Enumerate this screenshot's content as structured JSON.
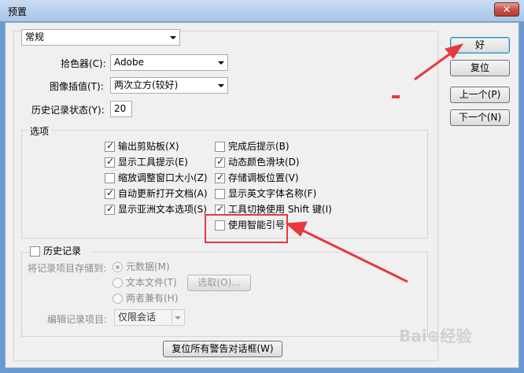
{
  "window": {
    "title": "预置",
    "close": "✕"
  },
  "general": {
    "section_select": "常规",
    "color_picker_label": "拾色器(C):",
    "color_picker_value": "Adobe",
    "interp_label": "图像插值(T):",
    "interp_value": "两次立方(较好)",
    "history_states_label": "历史记录状态(Y):",
    "history_states_value": "20"
  },
  "options": {
    "title": "选项",
    "left": [
      {
        "label": "输出剪贴板(X)",
        "checked": true
      },
      {
        "label": "显示工具提示(E)",
        "checked": true
      },
      {
        "label": "缩放调整窗口大小(Z)",
        "checked": false
      },
      {
        "label": "自动更新打开文档(A)",
        "checked": true
      },
      {
        "label": "显示亚洲文本选项(S)",
        "checked": true
      }
    ],
    "right": [
      {
        "label": "完成后提示(B)",
        "checked": false
      },
      {
        "label": "动态颜色滑块(D)",
        "checked": true
      },
      {
        "label": "存储调板位置(V)",
        "checked": true
      },
      {
        "label": "显示英文字体名称(F)",
        "checked": false
      },
      {
        "label": "工具切换使用 Shift 键(I)",
        "checked": true
      },
      {
        "label": "使用智能引号",
        "checked": false
      }
    ]
  },
  "history": {
    "title": "历史记录",
    "save_to_label": "将记录项目存储到:",
    "radio_metadata": "元数据(M)",
    "radio_textfile": "文本文件(T)",
    "radio_both": "两者兼有(H)",
    "choose_button": "选取(O)...",
    "edit_log_label": "编辑记录项目:",
    "edit_log_value": "仅限会话"
  },
  "reset_warnings_button": "复位所有警告对话框(W)",
  "buttons": {
    "ok": "好",
    "reset": "复位",
    "prev": "上一个(P)",
    "next": "下一个(N)"
  },
  "accent": {
    "annotation": "#e8383d"
  }
}
